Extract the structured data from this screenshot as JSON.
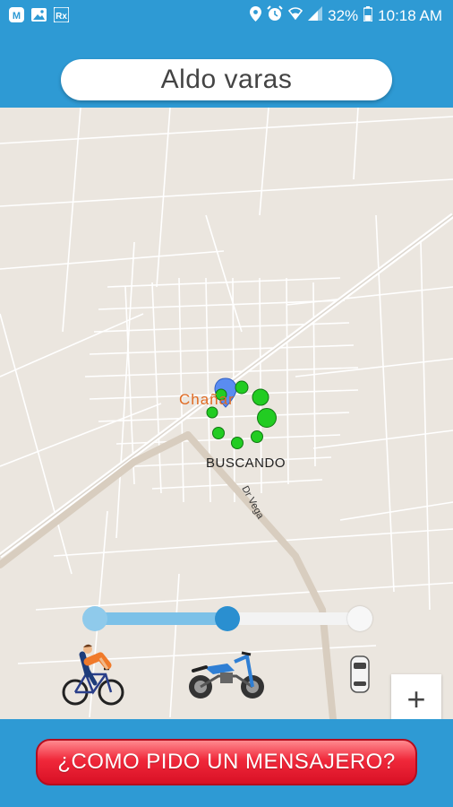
{
  "status_bar": {
    "battery_percent": "32%",
    "time": "10:18 AM"
  },
  "header": {
    "title": "Aldo varas"
  },
  "map": {
    "location_label": "Chañar",
    "status_text": "BUSCANDO",
    "street_label": "Dr Vega",
    "zoom_in_label": "+",
    "slider_level": 0.5
  },
  "vehicles": [
    "bicycle-icon",
    "motorcycle-icon"
  ],
  "bottom": {
    "cta_label": "¿COMO PIDO UN MENSAJERO?"
  },
  "colors": {
    "primary": "#2e9ad4",
    "map_bg": "#ebe6df",
    "marker_green": "#22cc22",
    "cta_red": "#f0283a",
    "label_orange": "#e06a22"
  }
}
